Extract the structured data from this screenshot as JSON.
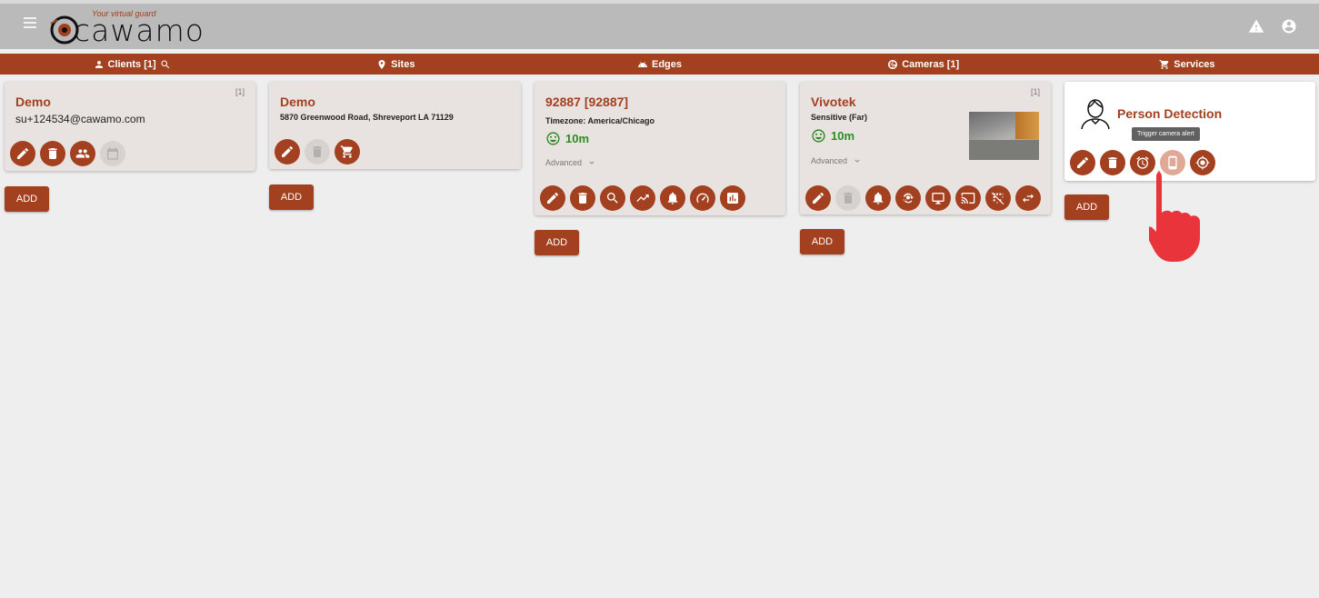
{
  "app": {
    "logo_tagline": "Your virtual guard",
    "logo_word": "cawamo"
  },
  "nav": {
    "clients": "Clients [1]",
    "sites": "Sites",
    "edges": "Edges",
    "cameras": "Cameras [1]",
    "services": "Services"
  },
  "clients": {
    "card": {
      "title": "Demo",
      "email": "su+124534@cawamo.com",
      "count": "[1]"
    },
    "add_label": "ADD"
  },
  "sites": {
    "card": {
      "title": "Demo",
      "address": "5870 Greenwood Road, Shreveport LA 71129"
    },
    "add_label": "ADD"
  },
  "edges": {
    "card": {
      "title": "92887 [92887]",
      "timezone": "Timezone: America/Chicago",
      "status": "10m",
      "advanced": "Advanced"
    },
    "add_label": "ADD"
  },
  "cameras": {
    "card": {
      "title": "Vivotek",
      "sensitivity": "Sensitive (Far)",
      "status": "10m",
      "advanced": "Advanced",
      "count": "[1]"
    },
    "add_label": "ADD"
  },
  "services": {
    "card": {
      "title": "Person Detection"
    },
    "tooltip": "Trigger camera alert",
    "add_label": "ADD"
  },
  "colors": {
    "brand": "#a3401f",
    "status_ok": "#2e8b23",
    "topbar": "#bababa",
    "pointer": "#e8343a"
  }
}
